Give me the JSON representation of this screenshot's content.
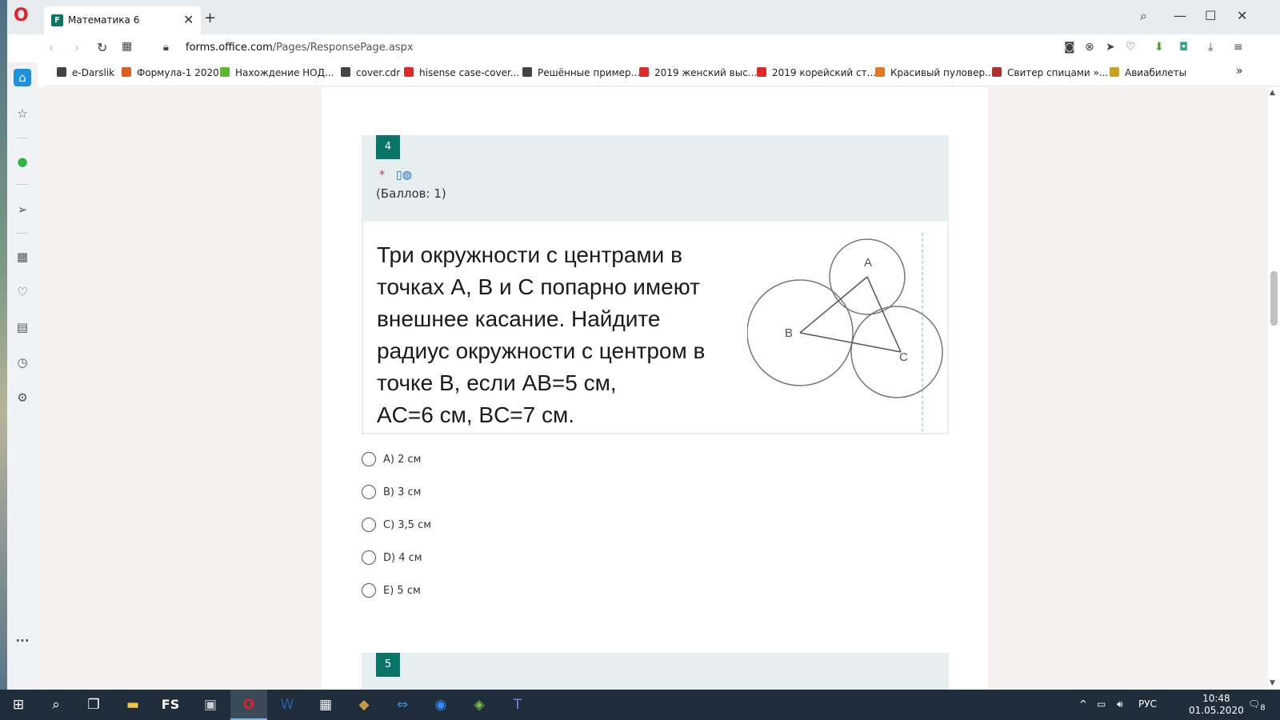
{
  "browser": {
    "tab_title": "Математика 6",
    "tab_favicon_text": "F",
    "url_domain": "forms.office.com",
    "url_path": "/Pages/ResponsePage.aspx"
  },
  "bookmarks": [
    {
      "label": "e-Darslik",
      "color": "#444444"
    },
    {
      "label": "Формула-1 2020",
      "color": "#e05a1e"
    },
    {
      "label": "Нахождение НОД...",
      "color": "#5cb82e"
    },
    {
      "label": "cover.cdr",
      "color": "#444444"
    },
    {
      "label": "hisense case-cover...",
      "color": "#e02a2a"
    },
    {
      "label": "Решённые пример...",
      "color": "#444444"
    },
    {
      "label": "2019 женский выс...",
      "color": "#e02a2a"
    },
    {
      "label": "2019 корейский ст...",
      "color": "#e02a2a"
    },
    {
      "label": "Красивый пуловер...",
      "color": "#e0781e"
    },
    {
      "label": "Свитер спицами »...",
      "color": "#b03030"
    },
    {
      "label": "Авиабилеты",
      "color": "#c9a21e"
    }
  ],
  "question": {
    "number": "4",
    "required_marker": "*",
    "points": "(Баллов: 1)",
    "problem_lines": [
      "Три окружности с центрами в",
      "точках A, B и C попарно имеют",
      "внешнее касание. Найдите",
      "радиус окружности с центром в",
      "точке B, если  AB=5 см,",
      "AC=6 см, BC=7 см."
    ],
    "diagram_labels": {
      "a": "A",
      "b": "B",
      "c": "C"
    },
    "options": [
      "A) 2 см",
      "B) 3 см",
      "C) 3,5 см",
      "D) 4 см",
      "E) 5 см"
    ]
  },
  "next_question": {
    "number": "5"
  },
  "taskbar": {
    "fs_label": "FS",
    "language": "РУС",
    "time": "10:48",
    "date": "01.05.2020",
    "notification_count": "8"
  },
  "colors": {
    "forms_accent": "#077568",
    "opera_red": "#e0202a",
    "required_red": "#c4314b",
    "question_header_bg": "#e6eef0"
  }
}
